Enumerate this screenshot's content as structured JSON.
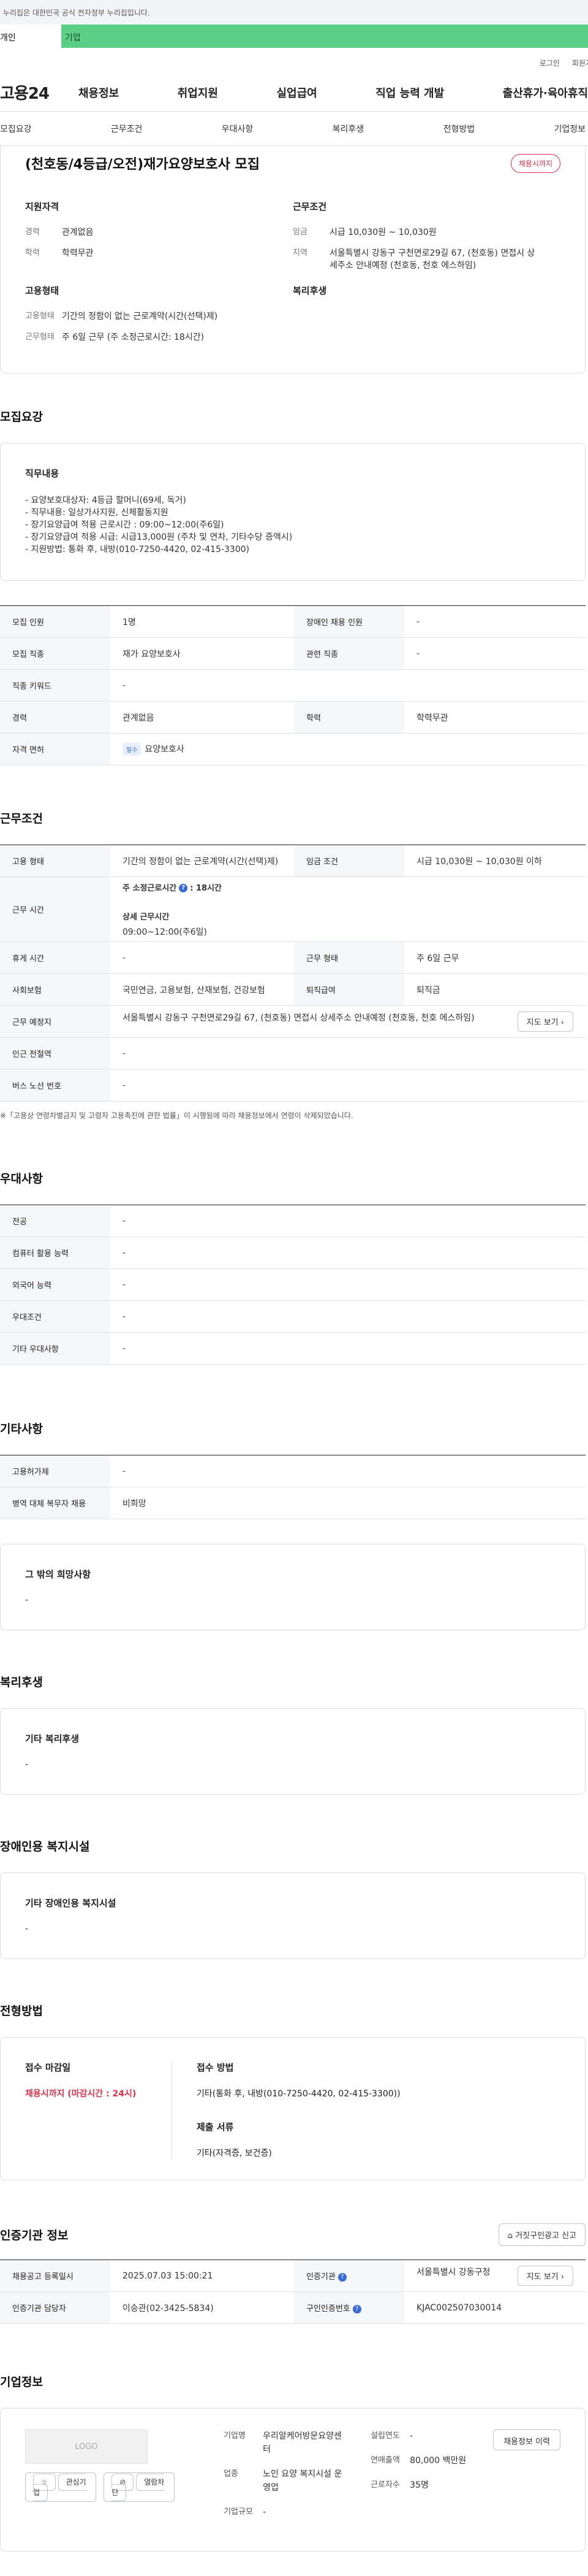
{
  "gov_banner": "이 누리집은 대한민국 공식 전자정부 누리집입니다.",
  "top_tabs": [
    "개인",
    "기업"
  ],
  "util_links": [
    "로그인",
    "회원가입"
  ],
  "logo": "고용24",
  "gnb": [
    "채용정보",
    "취업지원",
    "실업급여",
    "직업 능력 개발",
    "출산휴가·육아휴직"
  ],
  "subnav": [
    "모집요강",
    "근무조건",
    "우대사항",
    "복리후생",
    "전형방법",
    "기업정보"
  ],
  "title": "(천호동/4등급/오전)재가요양보호사 모집",
  "status_badge": "채용시까지",
  "summary": {
    "qual_heading": "지원자격",
    "career_k": "경력",
    "career_v": "관계없음",
    "edu_k": "학력",
    "edu_v": "학력무관",
    "emp_heading": "고용형태",
    "emptype_k": "고용형태",
    "emptype_v": "기간의 정함이 없는 근로계약(시간(선택)제)",
    "workshape_k": "근무형태",
    "workshape_v": "주 6일 근무 (주 소정근로시간: 18시간)",
    "cond_heading": "근무조건",
    "wage_k": "임금",
    "wage_v": "시급 10,030원 ~ 10,030원",
    "region_k": "지역",
    "region_v": "서울특별시 강동구 구천면로29길 67, (천호동) 면접시 상세주소 안내예정 (천호동, 천호 에스하임)",
    "welfare_heading": "복리후생"
  },
  "recruit": {
    "heading": "모집요강",
    "duty_heading": "직무내용",
    "duty_lines": [
      "- 요양보호대상자: 4등급 할머니(69세, 독거)",
      "- 직무내용: 일상가사지원, 신체활동지원",
      "- 장기요양급여 적용 근로시간 : 09:00~12:00(주6일)",
      "- 장기요양급여 적용 시급: 시급13,000원 (주차 및 연차, 기타수당 증액시)",
      "- 지원방법: 통화 후, 내방(010-7250-4420, 02-415-3300)"
    ],
    "rows": [
      {
        "k1": "모집 인원",
        "v1": "1명",
        "k2": "장애인 채용 인원",
        "v2": "-"
      },
      {
        "k1": "모집 직종",
        "v1": "재가 요양보호사",
        "k2": "관련 직종",
        "v2": "-"
      },
      {
        "k1": "직종 키워드",
        "v1": "-"
      },
      {
        "k1": "경력",
        "v1": "관계없음",
        "k2": "학력",
        "v2": "학력무관"
      },
      {
        "k1": "자격 면허",
        "chip": "필수",
        "v1": "요양보호사"
      }
    ]
  },
  "conditions": {
    "heading": "근무조건",
    "emp_k": "고용 형태",
    "emp_v": "기간의 정함이 없는 근로계약(시간(선택)제)",
    "wagec_k": "임금 조건",
    "wagec_v": "시급 10,030원 ~ 10,030원 이하",
    "time_k": "근무 시간",
    "time_label": "주 소정근로시간",
    "time_val": ": 18시간",
    "time_detail_label": "상세 근무시간",
    "time_detail": "09:00~12:00(주6일)",
    "rest_k": "휴게 시간",
    "rest_v": "-",
    "shape_k": "근무 형태",
    "shape_v": "주 6일 근무",
    "ins_k": "사회보험",
    "ins_v": "국민연금, 고용보험, 산재보험, 건강보험",
    "sev_k": "퇴직급여",
    "sev_v": "퇴직금",
    "place_k": "근무 예정지",
    "place_v": "서울특별시 강동구 구천면로29길 67, (천호동) 면접시 상세주소 안내예정 (천호동, 천호 에스하임)",
    "map_btn": "지도 보기",
    "subway_k": "인근 전철역",
    "subway_v": "-",
    "bus_k": "버스 노선 번호",
    "bus_v": "-",
    "note": "※「고용상 연령차별금지 및 고령자 고용촉진에 관한 법률」이 시행됨에 따라 채용정보에서 연령이 삭제되었습니다."
  },
  "prefs": {
    "heading": "우대사항",
    "rows": [
      {
        "k": "전공",
        "v": "-"
      },
      {
        "k": "컴퓨터 활용 능력",
        "v": "-"
      },
      {
        "k": "외국어 능력",
        "v": "-"
      },
      {
        "k": "우대조건",
        "v": "-"
      },
      {
        "k": "기타 우대사항",
        "v": "-"
      }
    ]
  },
  "etc": {
    "heading": "기타사항",
    "rows": [
      {
        "k": "고용허가제",
        "v": "-"
      },
      {
        "k": "병역 대체 복무자 채용",
        "v": "비희망"
      }
    ],
    "box_heading": "그 밖의 희망사항",
    "box_value": "-"
  },
  "welfare": {
    "heading": "복리후생",
    "box_heading": "기타 복리후생",
    "box_value": "-"
  },
  "disability": {
    "heading": "장애인용 복지시설",
    "box_heading": "기타 장애인용 복지시설",
    "box_value": "-"
  },
  "selection": {
    "heading": "전형방법",
    "deadline_h": "접수 마감일",
    "deadline_v": "채용시까지 (마감시간 : 24시)",
    "method_h": "접수 방법",
    "method_v": "기타(통화 후, 내방(010-7250-4420, 02-415-3300))",
    "docs_h": "제출 서류",
    "docs_v": "기타(자격증, 보건증)"
  },
  "posting": {
    "heading": "인증기관 정보",
    "report_btn": "거짓구인광고 신고",
    "rows": [
      {
        "k1": "채용공고 등록일시",
        "v1": "2025.07.03 15:00:21",
        "k2": "인증기관",
        "v2": "서울특별시 강동구청",
        "btn": "지도 보기"
      },
      {
        "k1": "인증기관 담당자",
        "v1": "이승관(02-3425-5834)",
        "k2": "구인인증번호",
        "v2": "KJAC002507030014"
      }
    ]
  },
  "company": {
    "heading": "기업정보",
    "logo_text": "LOGO",
    "fav_btn": "관심기업",
    "block_btn": "열람차단",
    "name_k": "기업명",
    "name_v": "우리알케어방문요양센터",
    "biz_k": "업종",
    "biz_v": "노인 요양 복지시설 운영업",
    "size_k": "기업규모",
    "size_v": "-",
    "year_k": "설립연도",
    "year_v": "-",
    "sales_k": "연매출액",
    "sales_v": "80,000 백만원",
    "staff_k": "근로자수",
    "staff_v": "35명",
    "jobs_btn": "채용정보 이력"
  }
}
